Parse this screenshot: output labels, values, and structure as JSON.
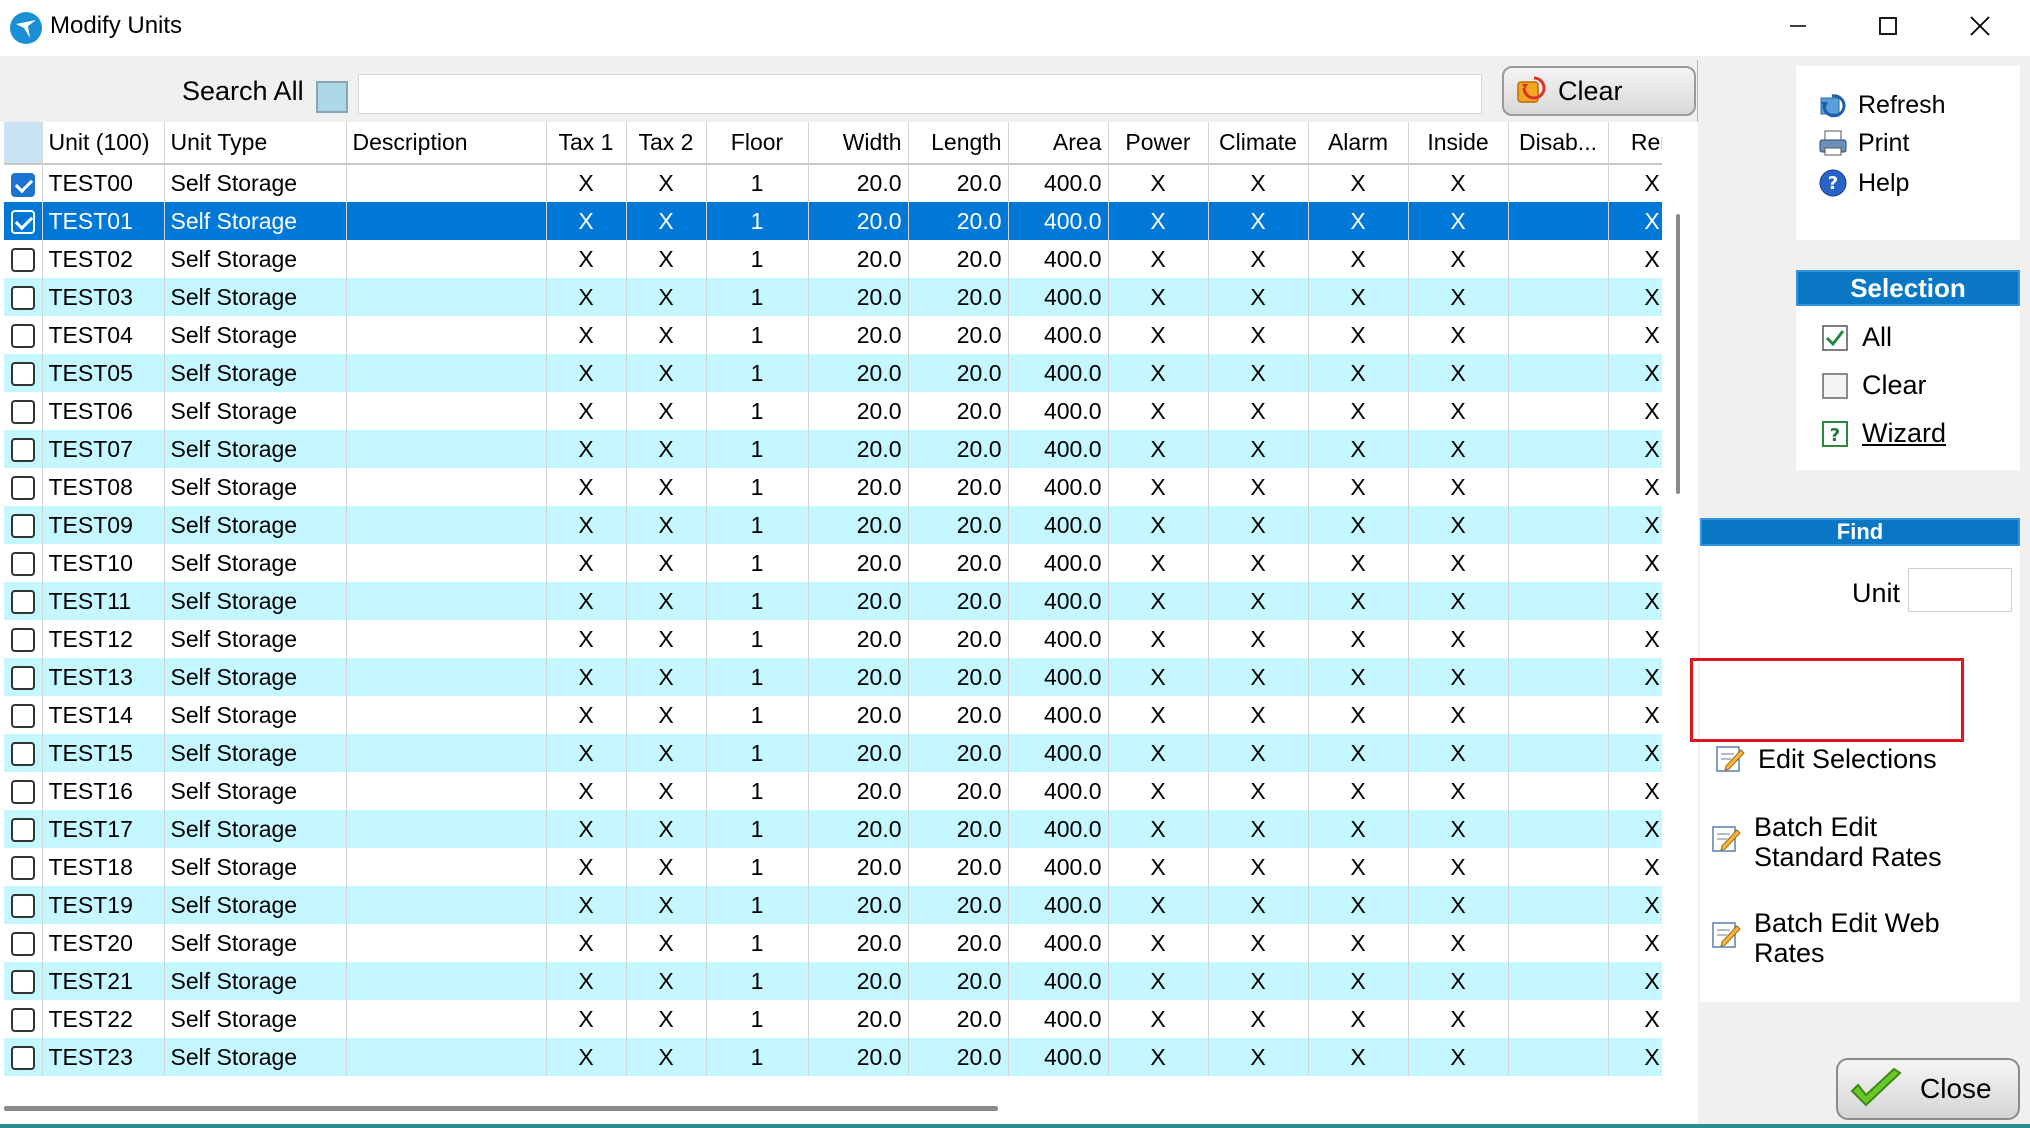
{
  "window": {
    "title": "Modify Units"
  },
  "search": {
    "label": "Search All",
    "value": "",
    "clear_label": "Clear"
  },
  "grid": {
    "columns": [
      "Unit (100)",
      "Unit Type",
      "Description",
      "Tax 1",
      "Tax 2",
      "Floor",
      "Width",
      "Length",
      "Area",
      "Power",
      "Climate",
      "Alarm",
      "Inside",
      "Disab...",
      "Ren"
    ],
    "rows": [
      {
        "checked": true,
        "selected": false,
        "cells": [
          "TEST00",
          "Self Storage",
          "",
          "X",
          "X",
          "1",
          "20.0",
          "20.0",
          "400.0",
          "X",
          "X",
          "X",
          "X",
          "",
          "X"
        ]
      },
      {
        "checked": true,
        "selected": true,
        "cells": [
          "TEST01",
          "Self Storage",
          "",
          "X",
          "X",
          "1",
          "20.0",
          "20.0",
          "400.0",
          "X",
          "X",
          "X",
          "X",
          "",
          "X"
        ]
      },
      {
        "checked": false,
        "selected": false,
        "cells": [
          "TEST02",
          "Self Storage",
          "",
          "X",
          "X",
          "1",
          "20.0",
          "20.0",
          "400.0",
          "X",
          "X",
          "X",
          "X",
          "",
          "X"
        ]
      },
      {
        "checked": false,
        "selected": false,
        "cells": [
          "TEST03",
          "Self Storage",
          "",
          "X",
          "X",
          "1",
          "20.0",
          "20.0",
          "400.0",
          "X",
          "X",
          "X",
          "X",
          "",
          "X"
        ]
      },
      {
        "checked": false,
        "selected": false,
        "cells": [
          "TEST04",
          "Self Storage",
          "",
          "X",
          "X",
          "1",
          "20.0",
          "20.0",
          "400.0",
          "X",
          "X",
          "X",
          "X",
          "",
          "X"
        ]
      },
      {
        "checked": false,
        "selected": false,
        "cells": [
          "TEST05",
          "Self Storage",
          "",
          "X",
          "X",
          "1",
          "20.0",
          "20.0",
          "400.0",
          "X",
          "X",
          "X",
          "X",
          "",
          "X"
        ]
      },
      {
        "checked": false,
        "selected": false,
        "cells": [
          "TEST06",
          "Self Storage",
          "",
          "X",
          "X",
          "1",
          "20.0",
          "20.0",
          "400.0",
          "X",
          "X",
          "X",
          "X",
          "",
          "X"
        ]
      },
      {
        "checked": false,
        "selected": false,
        "cells": [
          "TEST07",
          "Self Storage",
          "",
          "X",
          "X",
          "1",
          "20.0",
          "20.0",
          "400.0",
          "X",
          "X",
          "X",
          "X",
          "",
          "X"
        ]
      },
      {
        "checked": false,
        "selected": false,
        "cells": [
          "TEST08",
          "Self Storage",
          "",
          "X",
          "X",
          "1",
          "20.0",
          "20.0",
          "400.0",
          "X",
          "X",
          "X",
          "X",
          "",
          "X"
        ]
      },
      {
        "checked": false,
        "selected": false,
        "cells": [
          "TEST09",
          "Self Storage",
          "",
          "X",
          "X",
          "1",
          "20.0",
          "20.0",
          "400.0",
          "X",
          "X",
          "X",
          "X",
          "",
          "X"
        ]
      },
      {
        "checked": false,
        "selected": false,
        "cells": [
          "TEST10",
          "Self Storage",
          "",
          "X",
          "X",
          "1",
          "20.0",
          "20.0",
          "400.0",
          "X",
          "X",
          "X",
          "X",
          "",
          "X"
        ]
      },
      {
        "checked": false,
        "selected": false,
        "cells": [
          "TEST11",
          "Self Storage",
          "",
          "X",
          "X",
          "1",
          "20.0",
          "20.0",
          "400.0",
          "X",
          "X",
          "X",
          "X",
          "",
          "X"
        ]
      },
      {
        "checked": false,
        "selected": false,
        "cells": [
          "TEST12",
          "Self Storage",
          "",
          "X",
          "X",
          "1",
          "20.0",
          "20.0",
          "400.0",
          "X",
          "X",
          "X",
          "X",
          "",
          "X"
        ]
      },
      {
        "checked": false,
        "selected": false,
        "cells": [
          "TEST13",
          "Self Storage",
          "",
          "X",
          "X",
          "1",
          "20.0",
          "20.0",
          "400.0",
          "X",
          "X",
          "X",
          "X",
          "",
          "X"
        ]
      },
      {
        "checked": false,
        "selected": false,
        "cells": [
          "TEST14",
          "Self Storage",
          "",
          "X",
          "X",
          "1",
          "20.0",
          "20.0",
          "400.0",
          "X",
          "X",
          "X",
          "X",
          "",
          "X"
        ]
      },
      {
        "checked": false,
        "selected": false,
        "cells": [
          "TEST15",
          "Self Storage",
          "",
          "X",
          "X",
          "1",
          "20.0",
          "20.0",
          "400.0",
          "X",
          "X",
          "X",
          "X",
          "",
          "X"
        ]
      },
      {
        "checked": false,
        "selected": false,
        "cells": [
          "TEST16",
          "Self Storage",
          "",
          "X",
          "X",
          "1",
          "20.0",
          "20.0",
          "400.0",
          "X",
          "X",
          "X",
          "X",
          "",
          "X"
        ]
      },
      {
        "checked": false,
        "selected": false,
        "cells": [
          "TEST17",
          "Self Storage",
          "",
          "X",
          "X",
          "1",
          "20.0",
          "20.0",
          "400.0",
          "X",
          "X",
          "X",
          "X",
          "",
          "X"
        ]
      },
      {
        "checked": false,
        "selected": false,
        "cells": [
          "TEST18",
          "Self Storage",
          "",
          "X",
          "X",
          "1",
          "20.0",
          "20.0",
          "400.0",
          "X",
          "X",
          "X",
          "X",
          "",
          "X"
        ]
      },
      {
        "checked": false,
        "selected": false,
        "cells": [
          "TEST19",
          "Self Storage",
          "",
          "X",
          "X",
          "1",
          "20.0",
          "20.0",
          "400.0",
          "X",
          "X",
          "X",
          "X",
          "",
          "X"
        ]
      },
      {
        "checked": false,
        "selected": false,
        "cells": [
          "TEST20",
          "Self Storage",
          "",
          "X",
          "X",
          "1",
          "20.0",
          "20.0",
          "400.0",
          "X",
          "X",
          "X",
          "X",
          "",
          "X"
        ]
      },
      {
        "checked": false,
        "selected": false,
        "cells": [
          "TEST21",
          "Self Storage",
          "",
          "X",
          "X",
          "1",
          "20.0",
          "20.0",
          "400.0",
          "X",
          "X",
          "X",
          "X",
          "",
          "X"
        ]
      },
      {
        "checked": false,
        "selected": false,
        "cells": [
          "TEST22",
          "Self Storage",
          "",
          "X",
          "X",
          "1",
          "20.0",
          "20.0",
          "400.0",
          "X",
          "X",
          "X",
          "X",
          "",
          "X"
        ]
      },
      {
        "checked": false,
        "selected": false,
        "cells": [
          "TEST23",
          "Self Storage",
          "",
          "X",
          "X",
          "1",
          "20.0",
          "20.0",
          "400.0",
          "X",
          "X",
          "X",
          "X",
          "",
          "X"
        ]
      }
    ]
  },
  "toolbar": {
    "refresh_label": "Refresh",
    "print_label": "Print",
    "help_label": "Help"
  },
  "selection": {
    "heading": "Selection",
    "all_label": "All",
    "clear_label": "Clear",
    "wizard_label": "Wizard"
  },
  "find": {
    "heading": "Find",
    "unit_label": "Unit",
    "unit_value": ""
  },
  "actions": {
    "edit_selections": "Edit Selections",
    "batch_standard_line1": "Batch Edit",
    "batch_standard_line2": "Standard Rates",
    "batch_web_line1": "Batch Edit Web",
    "batch_web_line2": "Rates"
  },
  "footer": {
    "close_label": "Close"
  },
  "colors": {
    "row_alt": "#c4f7ff",
    "row_selected": "#0078d7",
    "panel_header": "#0a77c4",
    "highlight_border": "#e0141e"
  }
}
